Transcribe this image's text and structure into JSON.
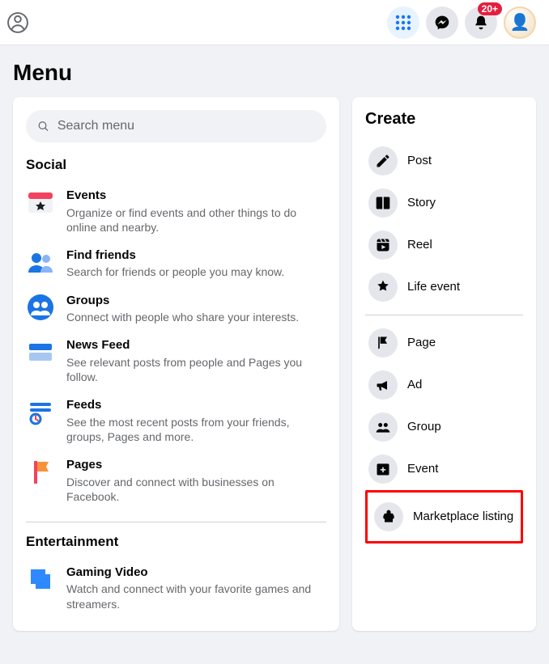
{
  "topbar": {
    "badge": "20+"
  },
  "page_title": "Menu",
  "search": {
    "placeholder": "Search menu"
  },
  "sections": [
    {
      "heading": "Social",
      "items": [
        {
          "title": "Events",
          "desc": "Organize or find events and other things to do online and nearby."
        },
        {
          "title": "Find friends",
          "desc": "Search for friends or people you may know."
        },
        {
          "title": "Groups",
          "desc": "Connect with people who share your interests."
        },
        {
          "title": "News Feed",
          "desc": "See relevant posts from people and Pages you follow."
        },
        {
          "title": "Feeds",
          "desc": "See the most recent posts from your friends, groups, Pages and more."
        },
        {
          "title": "Pages",
          "desc": "Discover and connect with businesses on Facebook."
        }
      ]
    },
    {
      "heading": "Entertainment",
      "items": [
        {
          "title": "Gaming Video",
          "desc": "Watch and connect with your favorite games and streamers."
        }
      ]
    }
  ],
  "create": {
    "heading": "Create",
    "group1": [
      {
        "label": "Post"
      },
      {
        "label": "Story"
      },
      {
        "label": "Reel"
      },
      {
        "label": "Life event"
      }
    ],
    "group2": [
      {
        "label": "Page"
      },
      {
        "label": "Ad"
      },
      {
        "label": "Group"
      },
      {
        "label": "Event"
      },
      {
        "label": "Marketplace listing"
      }
    ]
  }
}
